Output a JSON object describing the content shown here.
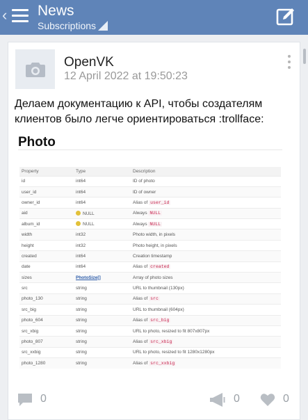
{
  "header": {
    "title": "News",
    "subtitle": "Subscriptions",
    "back_icon": "chevron-left-icon",
    "menu_icon": "hamburger-icon",
    "compose_icon": "compose-icon"
  },
  "post": {
    "author": "OpenVK",
    "date": "12 April 2022 at 19:50:23",
    "avatar_icon": "camera-icon",
    "text": "Делаем документацию к API, чтобы создателям клиентов было легче ориентироваться :trollface:",
    "image": {
      "title": "Photo",
      "columns": [
        "Property",
        "Type",
        "Description"
      ],
      "rows": [
        {
          "property": "id",
          "type": "int64",
          "desc": "ID of photo",
          "code": ""
        },
        {
          "property": "user_id",
          "type": "int64",
          "desc": "ID of owner",
          "code": ""
        },
        {
          "property": "owner_id",
          "type": "int64",
          "desc": "Alias of",
          "code": "user_id"
        },
        {
          "property": "aid",
          "type": "NULL",
          "desc": "Always",
          "code": "NULL",
          "type_badge": true
        },
        {
          "property": "album_id",
          "type": "NULL",
          "desc": "Always",
          "code": "NULL",
          "type_badge": true
        },
        {
          "property": "width",
          "type": "int32",
          "desc": "Photo width, in pixels",
          "code": ""
        },
        {
          "property": "height",
          "type": "int32",
          "desc": "Photo height, in pixels",
          "code": ""
        },
        {
          "property": "created",
          "type": "int64",
          "desc": "Creation timestamp",
          "code": ""
        },
        {
          "property": "date",
          "type": "int64",
          "desc": "Alias of",
          "code": "created"
        },
        {
          "property": "sizes",
          "type": "PhotoSize[]",
          "desc": "Array of photo sizes",
          "code": "",
          "type_link": true
        },
        {
          "property": "src",
          "type": "string",
          "desc": "URL to thumbnail (130px)",
          "code": ""
        },
        {
          "property": "photo_130",
          "type": "string",
          "desc": "Alias of",
          "code": "src"
        },
        {
          "property": "src_big",
          "type": "string",
          "desc": "URL to thumbnail (604px)",
          "code": ""
        },
        {
          "property": "photo_604",
          "type": "string",
          "desc": "Alias of",
          "code": "src_big"
        },
        {
          "property": "src_xbig",
          "type": "string",
          "desc": "URL to photo, resized to fit 807x807px",
          "code": ""
        },
        {
          "property": "photo_807",
          "type": "string",
          "desc": "Alias of",
          "code": "src_xbig"
        },
        {
          "property": "src_xxbig",
          "type": "string",
          "desc": "URL to photo, resized to fit 1280x1280px",
          "code": ""
        },
        {
          "property": "photo_1280",
          "type": "string",
          "desc": "Alias of",
          "code": "src_xxbig"
        }
      ]
    },
    "actions": {
      "comments": "0",
      "shares": "0",
      "likes": "0"
    }
  },
  "colors": {
    "header_bg": "#5f84b8",
    "page_bg": "#edeff2",
    "muted_text": "#9aa0a6",
    "code_text": "#c7254e"
  }
}
